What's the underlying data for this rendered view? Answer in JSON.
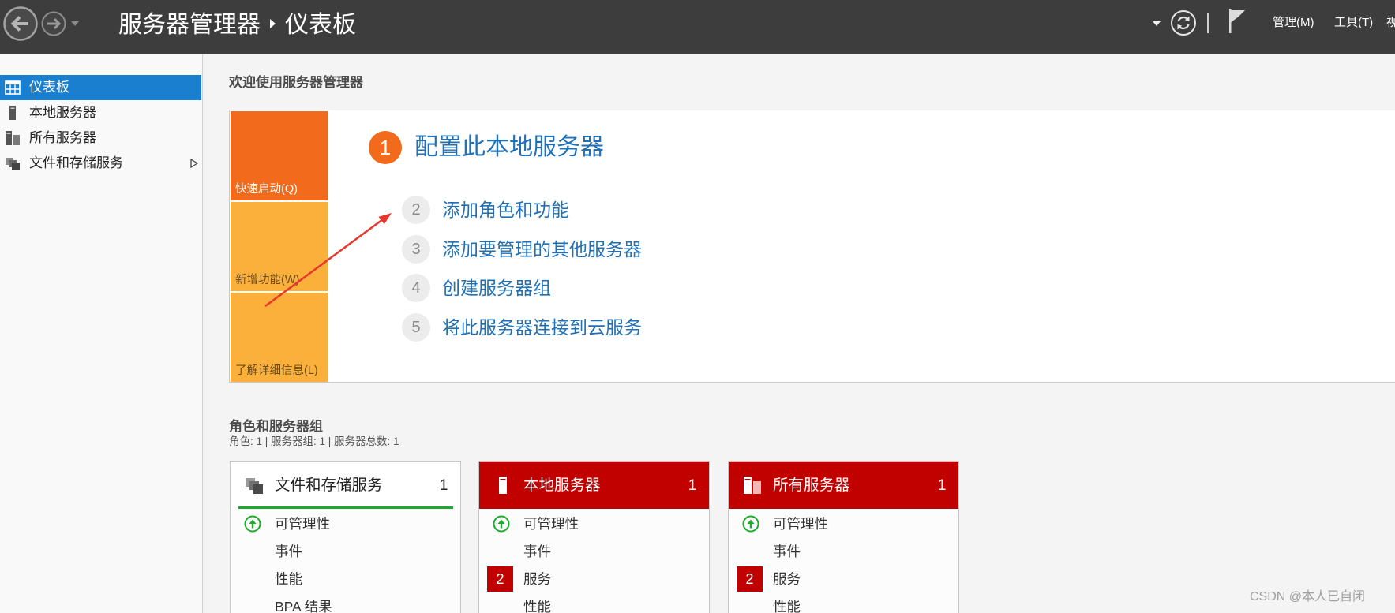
{
  "window": {
    "app_title": "服务器管理器",
    "page_title": "仪表板",
    "breadcrumb_separator_icon": "chevron-right-icon",
    "nav": {
      "back_icon": "back-arrow-icon",
      "forward_icon": "forward-arrow-icon",
      "history_icon": "chevron-down-icon"
    },
    "toolbar": {
      "dropdown_icon": "chevron-down-icon",
      "refresh_icon": "refresh-icon",
      "notifications_icon": "flag-icon"
    },
    "menu": {
      "manage_label": "管理(M)",
      "tools_label": "工具(T)",
      "view_label": "视"
    }
  },
  "sidebar": {
    "items": [
      {
        "label": "仪表板",
        "icon": "dashboard-icon"
      },
      {
        "label": "本地服务器",
        "icon": "local-server-icon"
      },
      {
        "label": "所有服务器",
        "icon": "all-servers-icon"
      },
      {
        "label": "文件和存储服务",
        "icon": "file-storage-icon",
        "submenu_icon": "expand-arrow-icon"
      }
    ]
  },
  "welcome": {
    "heading": "欢迎使用服务器管理器",
    "tiles": [
      {
        "label": "快速启动(Q)"
      },
      {
        "label": "新增功能(W)"
      },
      {
        "label": "了解详细信息(L)"
      }
    ],
    "steps": [
      {
        "number": "1",
        "label": "配置此本地服务器"
      },
      {
        "number": "2",
        "label": "添加角色和功能"
      },
      {
        "number": "3",
        "label": "添加要管理的其他服务器"
      },
      {
        "number": "4",
        "label": "创建服务器组"
      },
      {
        "number": "5",
        "label": "将此服务器连接到云服务"
      }
    ]
  },
  "annotation": {
    "icon": "red-arrow-annotation"
  },
  "roles": {
    "heading": "角色和服务器组",
    "summary": "角色: 1 | 服务器组: 1 | 服务器总数: 1",
    "cards": [
      {
        "title": "文件和存储服务",
        "count": "1",
        "icon": "file-storage-icon",
        "header_color": "#ffffff",
        "header_text_color": "#222222",
        "status_bar_color": "#1aab2a",
        "rows": [
          {
            "label": "可管理性",
            "icon": "status-ok-icon"
          },
          {
            "label": "事件"
          },
          {
            "label": "性能"
          },
          {
            "label": "BPA 结果"
          }
        ]
      },
      {
        "title": "本地服务器",
        "count": "1",
        "icon": "local-server-icon",
        "header_color": "#c10000",
        "header_text_color": "#ffffff",
        "rows": [
          {
            "label": "可管理性",
            "icon": "status-ok-icon"
          },
          {
            "label": "事件"
          },
          {
            "label": "服务",
            "badge": "2"
          },
          {
            "label": "性能"
          }
        ]
      },
      {
        "title": "所有服务器",
        "count": "1",
        "icon": "all-servers-icon",
        "header_color": "#c10000",
        "header_text_color": "#ffffff",
        "rows": [
          {
            "label": "可管理性",
            "icon": "status-ok-icon"
          },
          {
            "label": "事件"
          },
          {
            "label": "服务",
            "badge": "2"
          },
          {
            "label": "性能"
          }
        ]
      }
    ]
  },
  "watermark": "CSDN @本人已自闭",
  "colors": {
    "topbar_bg": "#3d3d3d",
    "selected_bg": "#1b7fd0",
    "quick_start_tile": "#f26b1d",
    "secondary_tile": "#fbb03b",
    "step_primary": "#f26b1d",
    "link_blue": "#2170b5",
    "alert_red": "#c10000",
    "ok_green": "#1aab2a",
    "annotation_arrow": "#e8382d"
  }
}
